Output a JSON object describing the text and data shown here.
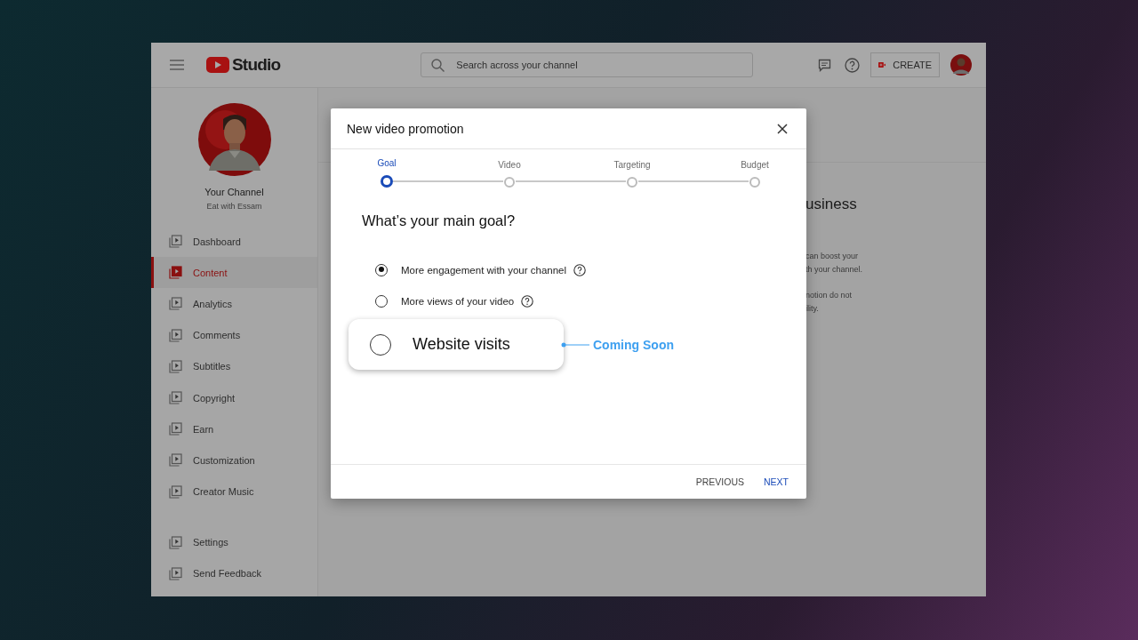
{
  "topbar": {
    "logo_text": "Studio",
    "search": {
      "placeholder": "Search across your channel"
    },
    "create_button": "CREATE"
  },
  "sidebar": {
    "channel_title": "Your Channel",
    "channel_name": "Eat with Essam",
    "items": [
      {
        "label": "Dashboard",
        "selected": false
      },
      {
        "label": "Content",
        "selected": true
      },
      {
        "label": "Analytics",
        "selected": false
      },
      {
        "label": "Comments",
        "selected": false
      },
      {
        "label": "Subtitles",
        "selected": false
      },
      {
        "label": "Copyright",
        "selected": false
      },
      {
        "label": "Earn",
        "selected": false
      },
      {
        "label": "Customization",
        "selected": false
      },
      {
        "label": "Creator Music",
        "selected": false
      }
    ],
    "footer_items": [
      {
        "label": "Settings",
        "selected": false
      },
      {
        "label": "Send Feedback",
        "selected": false
      }
    ]
  },
  "background_panel": {
    "heading": "usiness",
    "paragraphs": [
      {
        "lines": [
          "can boost your",
          "th your channel."
        ]
      },
      {
        "lines": [
          "notion do not",
          "ility."
        ]
      }
    ]
  },
  "dialog": {
    "title": "New video promotion",
    "steps": [
      {
        "label": "Goal",
        "selected": true
      },
      {
        "label": "Video",
        "selected": false
      },
      {
        "label": "Targeting",
        "selected": false
      },
      {
        "label": "Budget",
        "selected": false
      }
    ],
    "question": "What’s your main goal?",
    "options": [
      {
        "label": "More engagement with your channel",
        "selected": true,
        "help": true,
        "kind": "plain"
      },
      {
        "label": "More views of your video",
        "selected": false,
        "help": true,
        "kind": "plain"
      },
      {
        "label": "Website visits",
        "selected": false,
        "help": false,
        "kind": "callout",
        "note": "Coming Soon"
      }
    ],
    "buttons": [
      {
        "label": "PREVIOUS",
        "kind": "secondary"
      },
      {
        "label": "NEXT",
        "kind": "primary"
      }
    ]
  }
}
